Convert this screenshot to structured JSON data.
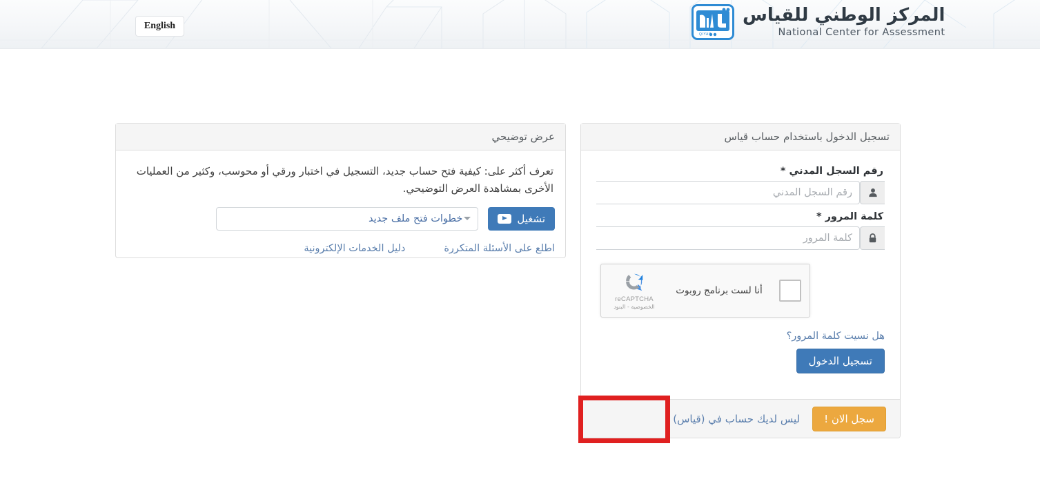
{
  "header": {
    "lang_button": "English",
    "brand_ar": "المركز الوطني للقياس",
    "brand_en": "National Center for Assessment",
    "logo_text": "QIYAS"
  },
  "demo_panel": {
    "title": "عرض توضيحي",
    "description": "تعرف أكثر على: كيفية فتح حساب جديد، التسجيل في اختبار ورقي أو محوسب، وكثير من العمليات الأخرى بمشاهدة العرض التوضيحي.",
    "select_value": "خطوات فتح ملف جديد",
    "play_button": "تشغيل",
    "links": [
      {
        "label": "اطلع على الأسئلة المتكررة"
      },
      {
        "label": "دليل الخدمات الإلكترونية"
      }
    ]
  },
  "login_panel": {
    "title": "تسجيل الدخول باستخدام حساب قياس",
    "national_id": {
      "label": "رقم السجل المدني *",
      "placeholder": "رقم السجل المدني",
      "value": ""
    },
    "password": {
      "label": "كلمة المرور *",
      "placeholder": "كلمة المرور",
      "value": ""
    },
    "recaptcha": {
      "label": "أنا لست برنامج روبوت",
      "brand": "reCAPTCHA",
      "terms": "الخصوصية - البنود"
    },
    "forgot_password": "هل نسيت كلمة المرور؟",
    "login_button": "تسجيل الدخول",
    "footer_note": "ليس لديك حساب في (قياس)",
    "signup_button": "سجل الان !"
  },
  "colors": {
    "primary_blue": "#3f7ab8",
    "link_blue": "#5b7fad",
    "accent_orange": "#eca83f",
    "highlight_red": "#e02020",
    "panel_border": "#dddddd",
    "panel_heading_bg": "#f5f5f5"
  }
}
